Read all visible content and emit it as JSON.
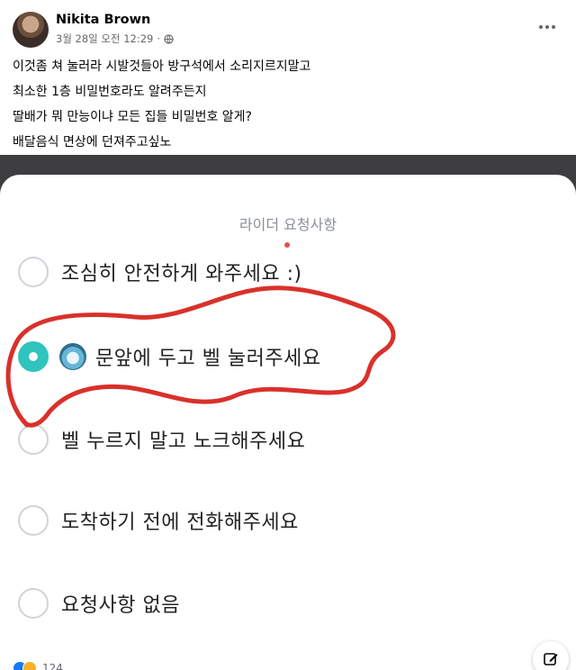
{
  "post": {
    "author": "Nikita Brown",
    "timestamp": "3월 28일 오전 12:29",
    "separator": "·",
    "privacy_icon": "globe-icon",
    "more_icon": "more-icon",
    "caption": [
      "이것좀 쳐 눌러라 시발것들아 방구석에서 소리지르지말고",
      "최소한 1층 비밀번호라도 알려주든지",
      "딸배가 뭐 만능이냐 모든 집들 비밀번호 알게?",
      "배달음식 면상에 던져주고싶노"
    ]
  },
  "image": {
    "title": "라이더 요청사항",
    "options": [
      {
        "label": "조심히 안전하게 와주세요 :)",
        "selected": false
      },
      {
        "label": "문앞에 두고 벨 눌러주세요",
        "selected": true,
        "icon": "robot-avatar-icon"
      },
      {
        "label": "벨 누르지 말고 노크해주세요",
        "selected": false
      },
      {
        "label": "도착하기 전에 전화해주세요",
        "selected": false
      },
      {
        "label": "요청사항 없음",
        "selected": false
      }
    ],
    "accent_color": "#2fc4bd",
    "scribble_color": "#d9312b"
  },
  "footer": {
    "reaction_count": "124",
    "reaction_icons": [
      "like-icon",
      "care-icon"
    ],
    "edit_icon": "edit-icon"
  }
}
